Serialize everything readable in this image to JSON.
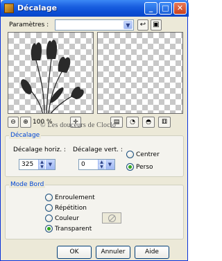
{
  "window": {
    "title": "Décalage"
  },
  "params": {
    "label": "Paramètres :",
    "value": ""
  },
  "zoom": {
    "value": "100 %"
  },
  "watermark": {
    "text": "© Les douceurs de Cloclo"
  },
  "decalage": {
    "title": "Décalage",
    "horiz_label": "Décalage horiz. :",
    "horiz_value": "325",
    "vert_label": "Décalage vert. :",
    "vert_value": "0",
    "options": [
      {
        "label": "Centrer",
        "checked": false
      },
      {
        "label": "Perso",
        "checked": true
      }
    ]
  },
  "mode_bord": {
    "title": "Mode Bord",
    "options": [
      {
        "label": "Enroulement",
        "checked": false
      },
      {
        "label": "Répétition",
        "checked": false
      },
      {
        "label": "Couleur",
        "checked": false
      },
      {
        "label": "Transparent",
        "checked": true
      }
    ]
  },
  "buttons": {
    "ok": "OK",
    "cancel": "Annuler",
    "help": "Aide"
  }
}
